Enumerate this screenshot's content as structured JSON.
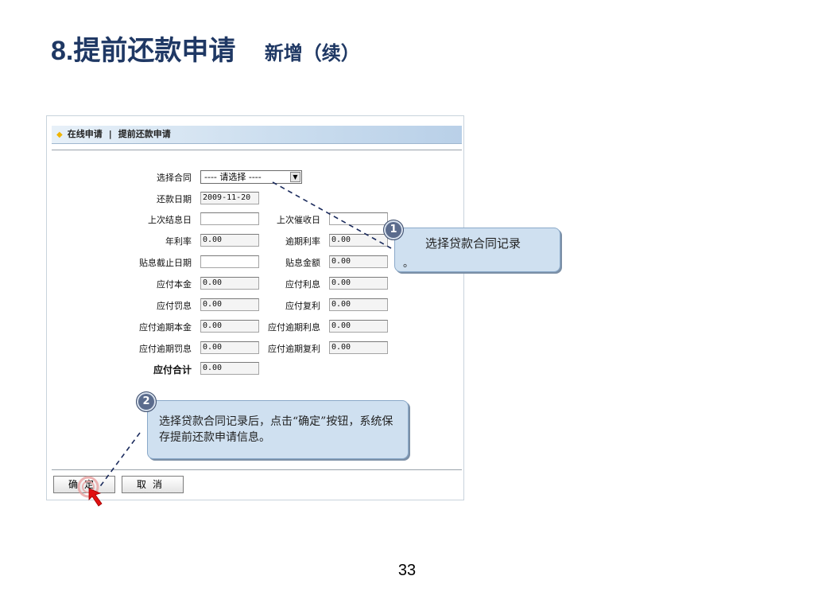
{
  "slide": {
    "title_num": "8.",
    "title_text": "提前还款申请",
    "subtitle": "新增（续）",
    "page_number": "33"
  },
  "panel": {
    "breadcrumb_online": "在线申请",
    "breadcrumb_sep": "|",
    "breadcrumb_current": "提前还款申请"
  },
  "form": {
    "contract_label": "选择合同",
    "contract_select": "---- 请选择 ----",
    "repay_date_label": "还款日期",
    "repay_date_value": "2009-11-20",
    "last_settle_label": "上次结息日",
    "last_settle_value": "",
    "last_collect_label": "上次催收日",
    "last_collect_value": "",
    "annual_rate_label": "年利率",
    "annual_rate_value": "0.00",
    "overdue_rate_label": "逾期利率",
    "overdue_rate_value": "0.00",
    "discount_end_label": "贴息截止日期",
    "discount_end_value": "",
    "discount_amount_label": "贴息金额",
    "discount_amount_value": "0.00",
    "principal_label": "应付本金",
    "principal_value": "0.00",
    "interest_label": "应付利息",
    "interest_value": "0.00",
    "penalty_label": "应付罚息",
    "penalty_value": "0.00",
    "compound_label": "应付复利",
    "compound_value": "0.00",
    "overdue_principal_label": "应付逾期本金",
    "overdue_principal_value": "0.00",
    "overdue_interest_label": "应付逾期利息",
    "overdue_interest_value": "0.00",
    "overdue_penalty_label": "应付逾期罚息",
    "overdue_penalty_value": "0.00",
    "overdue_compound_label": "应付逾期复利",
    "overdue_compound_value": "0.00",
    "total_label": "应付合计",
    "total_value": "0.00"
  },
  "buttons": {
    "confirm": "确定",
    "cancel": "取消"
  },
  "callouts": {
    "c1_num": "1",
    "c1_text": "选择贷款合同记录",
    "c1_tail": "。",
    "c2_num": "2",
    "c2_text": "选择贷款合同记录后，点击“确定”按钮，系统保存提前还款申请信息。"
  }
}
